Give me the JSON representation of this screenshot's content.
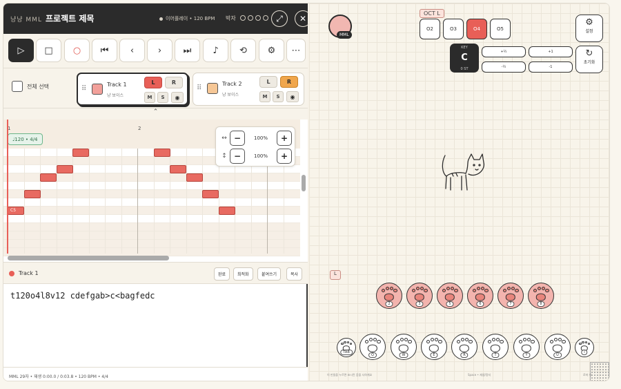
{
  "header": {
    "app_name": "냥냥 MML",
    "project_title": "프로젝트 제목",
    "meta": "이어플레이 • 120 BPM",
    "beat_label": "박자",
    "expand_icon": "expand-icon",
    "close_icon": "close-icon"
  },
  "toolbar": {
    "tools": [
      "play-icon",
      "stop-icon",
      "record-icon",
      "skip-start-icon",
      "prev-icon",
      "next-icon",
      "skip-end-icon",
      "note-icon",
      "loop-icon",
      "gear-icon",
      "more-icon"
    ]
  },
  "tracks": {
    "select_all_label": "전체 선택",
    "items": [
      {
        "name": "Track 1",
        "instrument": "냥 보이스",
        "color": "#f2a09a",
        "left": "L",
        "right": "R",
        "mute": "M",
        "solo": "S"
      },
      {
        "name": "Track 2",
        "instrument": "냥 보이스",
        "color": "#f6c796",
        "left": "L",
        "right": "R",
        "mute": "M",
        "solo": "S"
      }
    ]
  },
  "piano_roll": {
    "bars": [
      "1",
      "2"
    ],
    "tempo_chip": "♩120 • 4/4",
    "note_label": "C5",
    "zoom_h": "100%",
    "zoom_v": "100%"
  },
  "editor": {
    "track_label": "Track 1",
    "buttons": [
      "완료",
      "최적화",
      "붙여쓰기",
      "복사"
    ],
    "mml": "t120o4l8v12 cdefgab>c<bagfedc"
  },
  "status_bar": "MML 29자 • 재생 0:00.0 / 0:03.8 • 120 BPM • 4/4",
  "right": {
    "avatar_tag": "MML",
    "oct_label": "OCT L",
    "octaves": [
      {
        "label": "O2",
        "key": "Z"
      },
      {
        "label": "O3",
        "key": "X"
      },
      {
        "label": "O4",
        "key": "C",
        "active": true
      },
      {
        "label": "O5",
        "key": "V"
      }
    ],
    "key_label": "KEY",
    "key_value": "C",
    "key_sub": "0 ST",
    "shift_pills": [
      "+½",
      "+1",
      "-½",
      "-1"
    ],
    "settings_label": "설정",
    "reset_label": "초기화",
    "reset_key": "L",
    "l_tag": "L",
    "hint_left": "이 만들을 누르면 표시된 음을 사하게요",
    "hint_mid": "Space • 재생/정지",
    "hint_right": "로마 자"
  },
  "paw_top": [
    "2",
    "3",
    "5",
    "6",
    "7",
    "8"
  ],
  "paw_bottom": [
    "TAB",
    "Q",
    "W",
    "E",
    "R",
    "T",
    "Y",
    "U",
    "I"
  ]
}
